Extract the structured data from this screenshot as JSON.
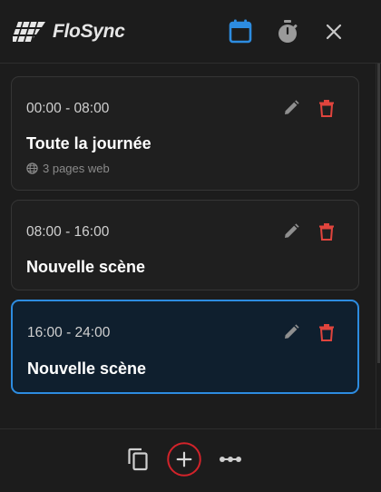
{
  "app": {
    "name": "FloSync",
    "accent": "#2d8ce0",
    "delete_color": "#e0443d"
  },
  "header": {
    "icons": [
      "calendar-icon",
      "timer-icon",
      "close-icon"
    ]
  },
  "scenes": [
    {
      "time": "00:00 - 08:00",
      "title": "Toute la journée",
      "meta": "3 pages web",
      "active": false
    },
    {
      "time": "08:00 - 16:00",
      "title": "Nouvelle scène",
      "active": false
    },
    {
      "time": "16:00 - 24:00",
      "title": "Nouvelle scène",
      "active": true
    }
  ],
  "footer": {
    "icons": [
      "copy-icon",
      "add-icon",
      "more-icon"
    ],
    "highlight_color": "#d2232a"
  }
}
